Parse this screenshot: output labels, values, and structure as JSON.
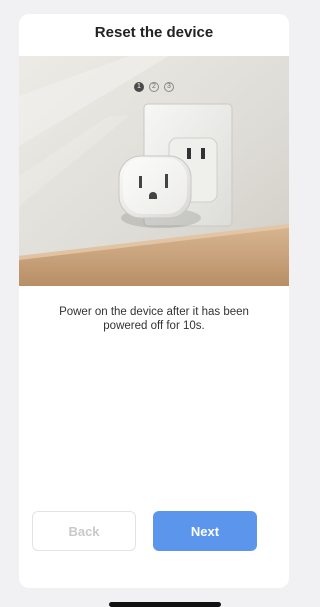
{
  "header": {
    "title": "Reset the device"
  },
  "steps": [
    {
      "label": "1",
      "state": "active"
    },
    {
      "label": "2",
      "state": "inactive"
    },
    {
      "label": "3",
      "state": "inactive"
    }
  ],
  "hero_image": {
    "subject": "smart plug in wall outlet"
  },
  "instruction": "Power on the device after it has been powered off for 10s.",
  "buttons": {
    "back": "Back",
    "next": "Next"
  },
  "colors": {
    "primary": "#5b95ec",
    "disabled_text": "#c9c9cc",
    "background": "#f1f1f3"
  }
}
